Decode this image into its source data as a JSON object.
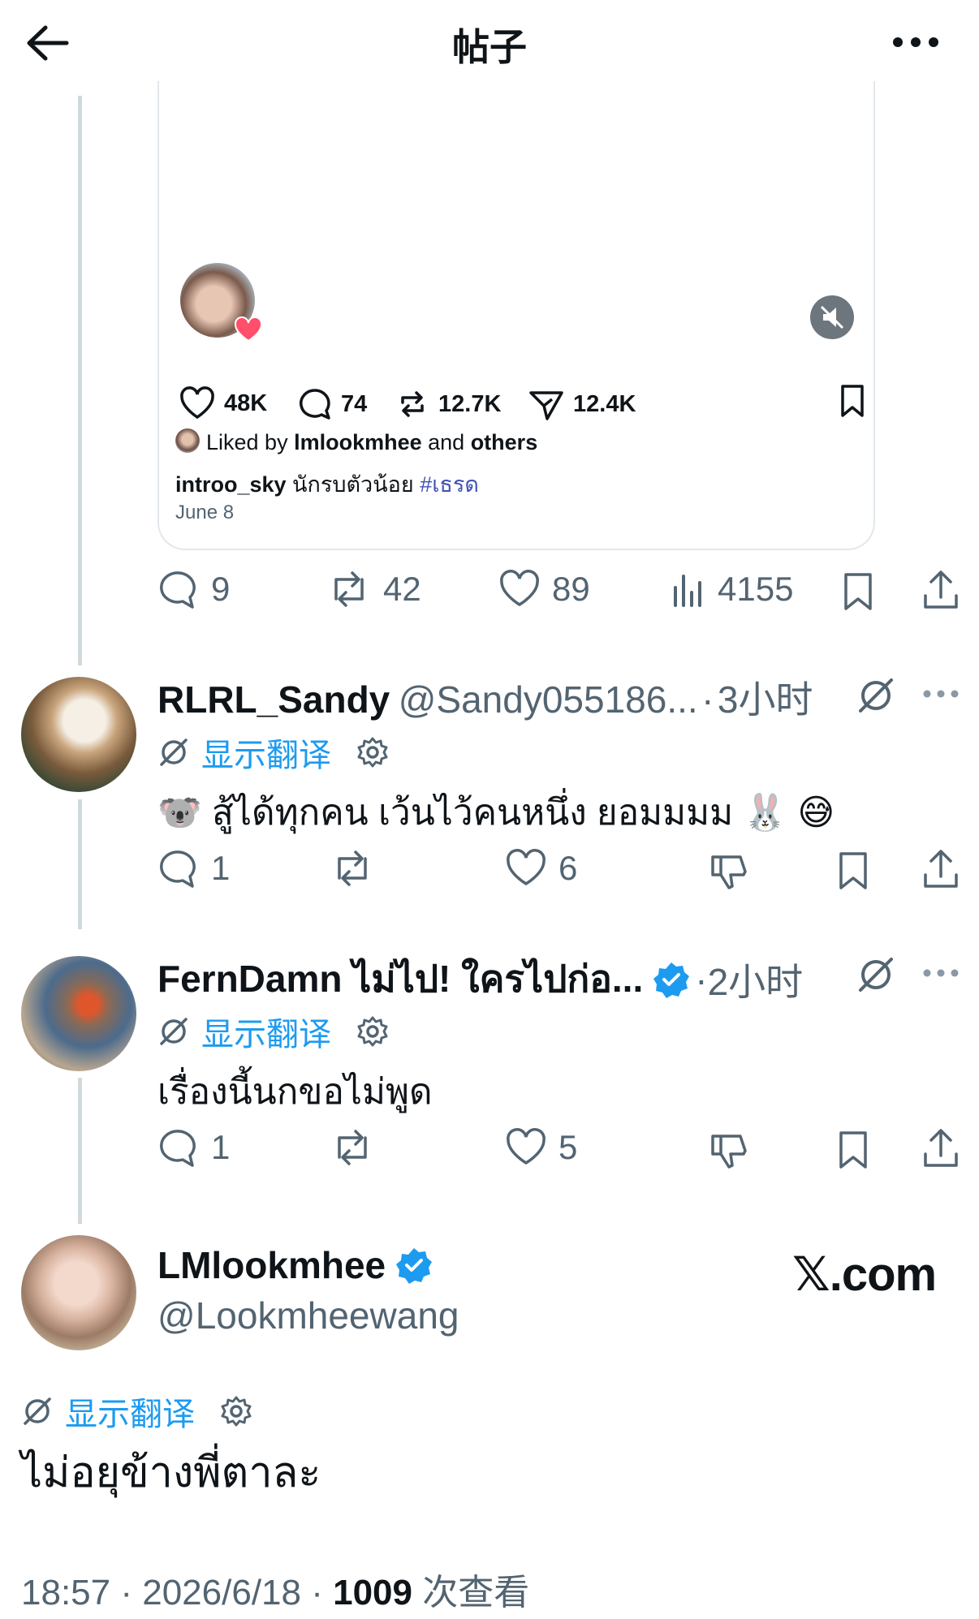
{
  "header": {
    "title": "帖子"
  },
  "embedded_card": {
    "stats": {
      "likes": "48K",
      "comments": "74",
      "reposts": "12.7K",
      "shares": "12.4K"
    },
    "liked_by_prefix": "Liked by ",
    "liked_by_user": "lmlookmhee",
    "liked_by_and": " and ",
    "liked_by_others": "others",
    "caption_user": "introo_sky",
    "caption_text": " นักรบตัวน้อย ",
    "caption_tag": "#เธรด",
    "date": "June 8"
  },
  "quoted_post_actions": {
    "replies": "9",
    "reposts": "42",
    "likes": "89",
    "views": "4155"
  },
  "replies": [
    {
      "name": "RLRL_Sandy",
      "handle": "@Sandy055186...",
      "sep": "·",
      "time": "3小时",
      "translate_label": "显示翻译",
      "text": "🐨 สู้ได้ทุกคน เว้นไว้คนหนึ่ง ยอมมมม 🐰 😅",
      "replies": "1",
      "reposts": "",
      "likes": "6"
    },
    {
      "name": "FernDamn ไม่ไป! ใครไปก่อ...",
      "sep": "·",
      "time": "2小时",
      "translate_label": "显示翻译",
      "text": "เรื่องนี้นกขอไม่พูด",
      "replies": "1",
      "reposts": "",
      "likes": "5"
    }
  ],
  "main_post": {
    "name": "LMlookmhee",
    "handle": "@Lookmheewang",
    "watermark": "𝕏.com",
    "translate_label": "显示翻译",
    "text": "ไม่อยุข้างพี่ตาละ",
    "time": "18:57",
    "sep1": "·",
    "date": "2026/6/18",
    "sep2": "·",
    "views_count": "1009",
    "views_label": "次查看"
  },
  "colors": {
    "accent": "#1d9bf0",
    "muted": "#536471",
    "line": "#cfd9de",
    "verified": "#1d9bf0"
  }
}
